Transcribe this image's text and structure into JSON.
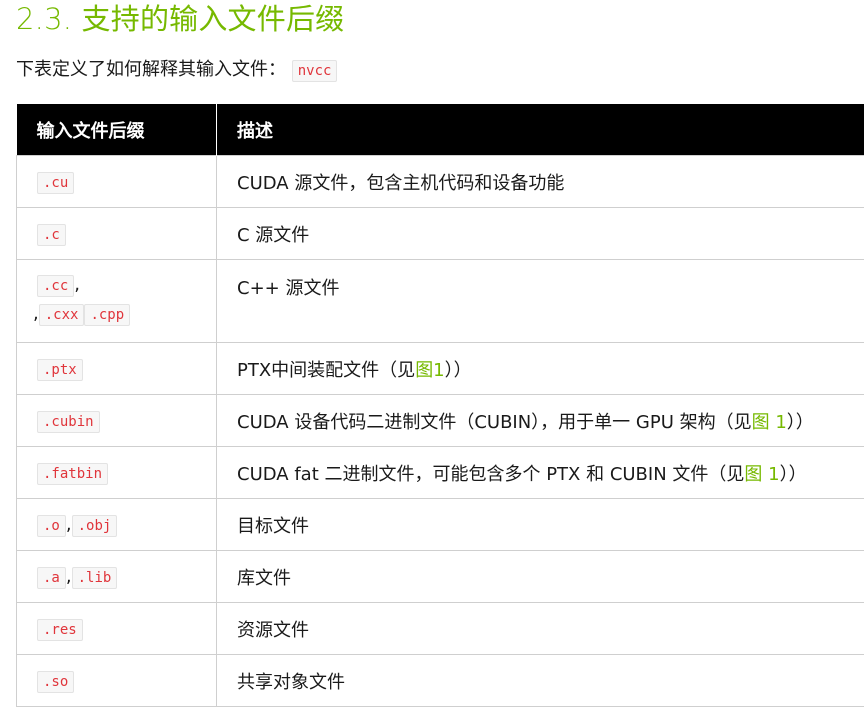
{
  "heading": "2.3. 支持的输入文件后缀",
  "intro": {
    "text": "下表定义了如何解释其输入文件：",
    "code": "nvcc"
  },
  "table": {
    "headers": [
      "输入文件后缀",
      "描述"
    ],
    "rows": [
      {
        "suffixes": [
          ".cu"
        ],
        "desc_text": "CUDA 源文件，包含主机代码和设备功能",
        "link": "",
        "desc_after": ""
      },
      {
        "suffixes": [
          ".c"
        ],
        "desc_text": "C 源文件",
        "link": "",
        "desc_after": ""
      },
      {
        "suffixes": [
          ".cc",
          ".cxx",
          ".cpp"
        ],
        "desc_text": "C++ 源文件",
        "link": "",
        "desc_after": ""
      },
      {
        "suffixes": [
          ".ptx"
        ],
        "desc_text": "PTX中间装配文件（见",
        "link": "图1",
        "desc_after": "））"
      },
      {
        "suffixes": [
          ".cubin"
        ],
        "desc_text": "CUDA 设备代码二进制文件（CUBIN），用于单一 GPU 架构（见",
        "link": "图 1",
        "desc_after": "））"
      },
      {
        "suffixes": [
          ".fatbin"
        ],
        "desc_text": "CUDA fat 二进制文件，可能包含多个 PTX 和 CUBIN 文件（见",
        "link": "图 1",
        "desc_after": "））"
      },
      {
        "suffixes": [
          ".o",
          ".obj"
        ],
        "desc_text": "目标文件",
        "link": "",
        "desc_after": ""
      },
      {
        "suffixes": [
          ".a",
          ".lib"
        ],
        "desc_text": "库文件",
        "link": "",
        "desc_after": ""
      },
      {
        "suffixes": [
          ".res"
        ],
        "desc_text": "资源文件",
        "link": "",
        "desc_after": ""
      },
      {
        "suffixes": [
          ".so"
        ],
        "desc_text": "共享对象文件",
        "link": "",
        "desc_after": ""
      }
    ]
  },
  "colors": {
    "accent": "#76b900",
    "code": "#e0353b",
    "header_bg": "#000000"
  }
}
